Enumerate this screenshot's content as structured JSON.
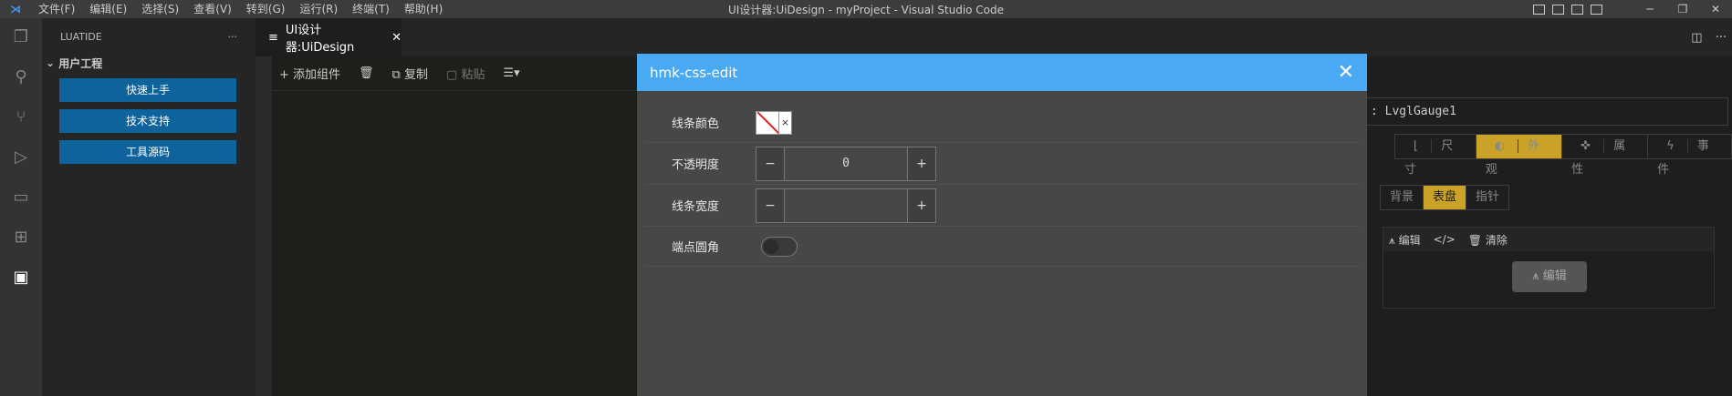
{
  "titlebar": {
    "menu": [
      "文件(F)",
      "编辑(E)",
      "选择(S)",
      "查看(V)",
      "转到(G)",
      "运行(R)",
      "终端(T)",
      "帮助(H)"
    ],
    "title": "UI设计器:UiDesign - myProject - Visual Studio Code",
    "controls": [
      "─",
      "❐",
      "✕"
    ]
  },
  "activity_icons": [
    "explorer-icon",
    "search-icon",
    "source-control-icon",
    "run-debug-icon",
    "remote-icon",
    "extensions-icon",
    "chip-icon"
  ],
  "sidebar": {
    "header": "LUATIDE",
    "more": "···",
    "section": "用户工程",
    "buttons": [
      "快速上手",
      "技术支持",
      "工具源码"
    ]
  },
  "tab": {
    "label": "UI设计器:UiDesign",
    "close": "✕"
  },
  "toolbar": {
    "add": "+ 添加组件",
    "delete": "🗑",
    "copy": "复制",
    "paste": "粘贴",
    "more": "☰▾"
  },
  "right_panel": {
    "component_name": ": LvglGauge1",
    "main_tabs": [
      "尺寸",
      "外观",
      "属性",
      "事件"
    ],
    "main_tab_active": "外观",
    "sub_tabs": [
      "背景",
      "表盘",
      "指针"
    ],
    "sub_tab_active": "表盘",
    "edit_header": [
      "编辑",
      "清除"
    ],
    "edit_button": "编辑"
  },
  "dialog": {
    "title": "hmk-css-edit",
    "close": "✕",
    "rows": {
      "line_color": {
        "label": "线条颜色",
        "clear": "×"
      },
      "opacity": {
        "label": "不透明度",
        "value": "0",
        "minus": "−",
        "plus": "+"
      },
      "line_width": {
        "label": "线条宽度",
        "value": "",
        "minus": "−",
        "plus": "+"
      },
      "round_ends": {
        "label": "端点圆角",
        "checked": false
      }
    }
  },
  "colors": {
    "accent_blue": "#4aa9f3",
    "button_blue": "#0e639c",
    "active_gold": "#c9a227"
  }
}
